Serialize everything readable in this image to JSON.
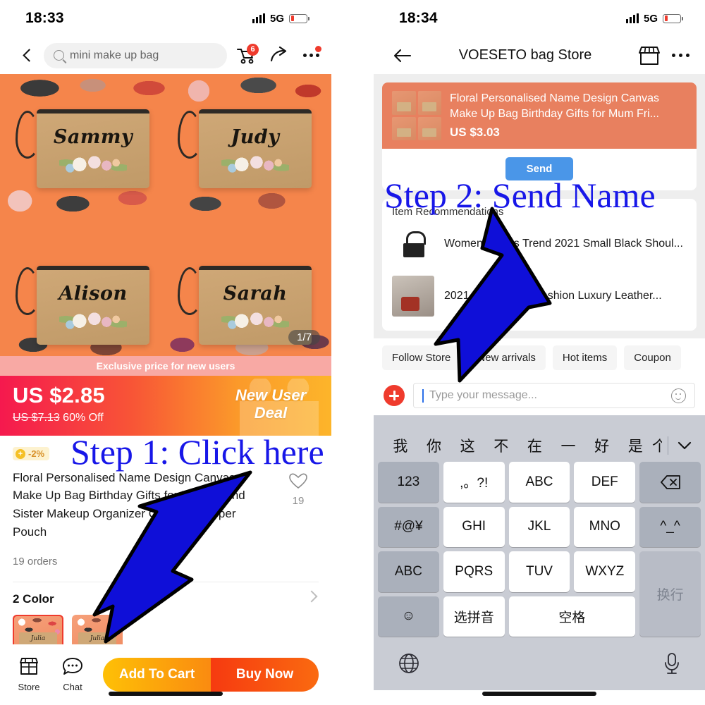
{
  "left": {
    "status": {
      "clock": "18:33",
      "network": "5G"
    },
    "nav": {
      "back_icon": "chevron-left-icon",
      "search_value": "mini make up bag",
      "cart_badge": "6",
      "share_icon": "share-icon",
      "more_icon": "more-dots-icon"
    },
    "hero": {
      "pouch_names": [
        "Sammy",
        "Judy",
        "Alison",
        "Sarah"
      ],
      "image_index": "1/7"
    },
    "promo": {
      "exclusive_label": "Exclusive price for new users",
      "price": "US $2.85",
      "original_price": "US $7.13",
      "discount": "60% Off",
      "deal_badge": "New User Deal",
      "deal_badge_line1": "New User",
      "deal_badge_line2": "Deal"
    },
    "detail": {
      "coin_badge": "-2%",
      "title": "Floral Personalised Name Design Canvas Make Up Bag Birthday Gifts for Mum Friend Sister Makeup Organizer Cosmetic Zipper Pouch",
      "likes": "19",
      "orders": "19 orders"
    },
    "color_section": {
      "heading": "2 Color",
      "swatch_label": "Julia"
    },
    "bottom": {
      "store_label": "Store",
      "chat_label": "Chat",
      "add_to_cart": "Add To Cart",
      "buy_now": "Buy Now"
    },
    "overlay_text": "Step 1: Click here"
  },
  "right": {
    "status": {
      "clock": "18:34",
      "network": "5G"
    },
    "nav": {
      "back_icon": "arrow-left-icon",
      "title": "VOESETO bag Store",
      "store_icon": "storefront-icon",
      "more_icon": "more-dots-icon"
    },
    "product_card": {
      "title": "Floral Personalised Name Design Canvas Make Up Bag Birthday Gifts for Mum Fri...",
      "price": "US $3.03",
      "send_label": "Send"
    },
    "recommendations": {
      "heading": "Item Recommendations",
      "items": [
        {
          "title": "Women's Bags Trend 2021 Small Black Shoul..."
        },
        {
          "title": "2021 New Ladies Fashion Luxury Leather..."
        }
      ]
    },
    "chips": [
      "Follow Store",
      "New arrivals",
      "Hot items",
      "Coupon"
    ],
    "input": {
      "placeholder": "Type your message...",
      "plus_icon": "plus-icon",
      "emoji_icon": "smiley-icon"
    },
    "keyboard": {
      "candidates": [
        "我",
        "你",
        "这",
        "不",
        "在",
        "一",
        "好",
        "是"
      ],
      "candidate_partial": "个",
      "expand_icon": "chevron-down-icon",
      "keys": [
        {
          "label": "123",
          "style": "fn"
        },
        {
          "label": ",。?!",
          "style": "letter"
        },
        {
          "label": "ABC",
          "style": "letter"
        },
        {
          "label": "DEF",
          "style": "letter"
        },
        {
          "label": "⌫",
          "style": "fn",
          "name": "backspace-key"
        },
        {
          "label": "#@¥",
          "style": "fn"
        },
        {
          "label": "GHI",
          "style": "letter"
        },
        {
          "label": "JKL",
          "style": "letter"
        },
        {
          "label": "MNO",
          "style": "letter"
        },
        {
          "label": "^_^",
          "style": "fn"
        },
        {
          "label": "ABC",
          "style": "fn"
        },
        {
          "label": "PQRS",
          "style": "letter"
        },
        {
          "label": "TUV",
          "style": "letter"
        },
        {
          "label": "WXYZ",
          "style": "letter"
        },
        {
          "label": "换行",
          "style": "dim",
          "name": "return-key"
        },
        {
          "label": "☺",
          "style": "fn",
          "name": "emoji-key"
        },
        {
          "label": "选拼音",
          "style": "letter"
        },
        {
          "label": "空格",
          "style": "letter",
          "name": "space-key"
        }
      ],
      "globe_icon": "globe-icon",
      "mic_icon": "microphone-icon"
    },
    "overlay_text": "Step 2: Send Name"
  }
}
